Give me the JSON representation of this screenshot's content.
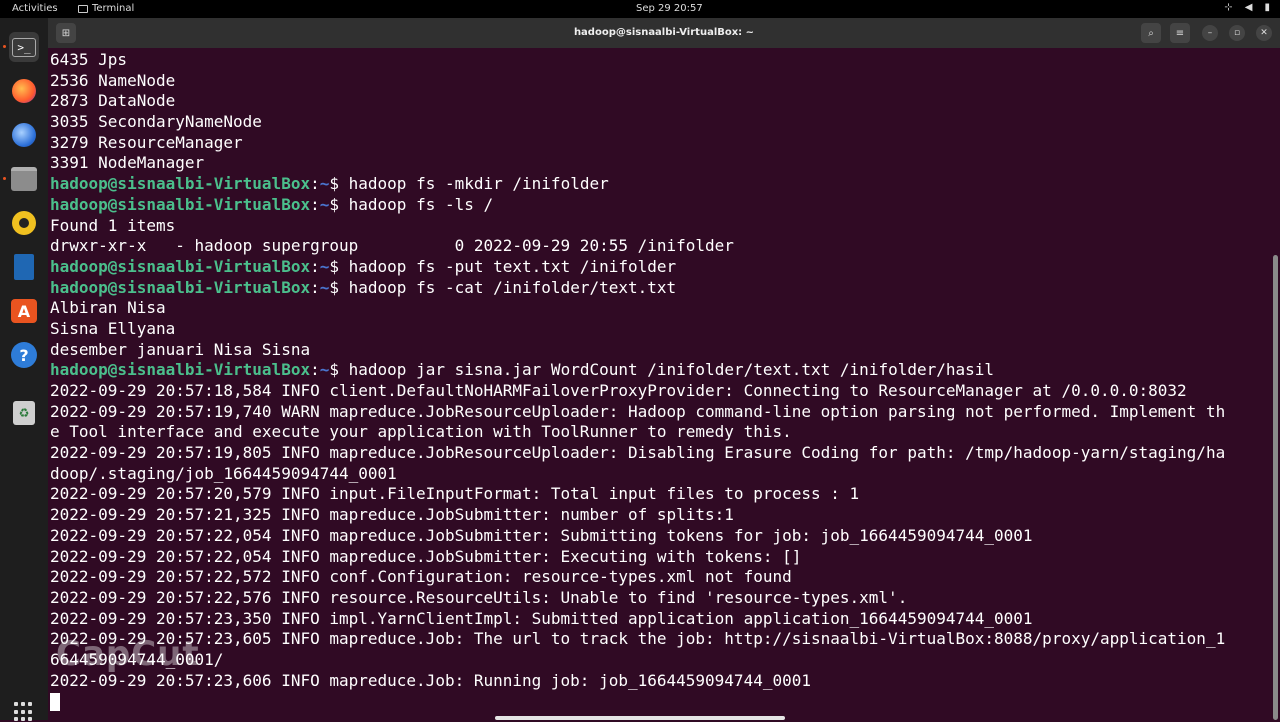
{
  "topbar": {
    "activities": "Activities",
    "app_name": "Terminal",
    "clock": "Sep 29  20:57"
  },
  "window": {
    "title": "hadoop@sisnaalbi-VirtualBox: ~"
  },
  "dock": {
    "items": [
      "terminal",
      "firefox",
      "thunderbird",
      "files",
      "rhythmbox",
      "libreoffice-writer",
      "app-center",
      "help",
      "trash"
    ]
  },
  "terminal": {
    "lines": [
      {
        "text": "6435 Jps"
      },
      {
        "text": "2536 NameNode"
      },
      {
        "text": "2873 DataNode"
      },
      {
        "text": "3035 SecondaryNameNode"
      },
      {
        "text": "3279 ResourceManager"
      },
      {
        "text": "3391 NodeManager"
      },
      {
        "prompt": true,
        "user": "hadoop@sisnaalbi-VirtualBox",
        "path": "~",
        "cmd": "$ hadoop fs -mkdir /inifolder"
      },
      {
        "prompt": true,
        "user": "hadoop@sisnaalbi-VirtualBox",
        "path": "~",
        "cmd": "$ hadoop fs -ls /"
      },
      {
        "text": "Found 1 items"
      },
      {
        "text": "drwxr-xr-x   - hadoop supergroup          0 2022-09-29 20:55 /inifolder"
      },
      {
        "prompt": true,
        "user": "hadoop@sisnaalbi-VirtualBox",
        "path": "~",
        "cmd": "$ hadoop fs -put text.txt /inifolder"
      },
      {
        "prompt": true,
        "user": "hadoop@sisnaalbi-VirtualBox",
        "path": "~",
        "cmd": "$ hadoop fs -cat /inifolder/text.txt"
      },
      {
        "text": "Albiran Nisa"
      },
      {
        "text": "Sisna Ellyana"
      },
      {
        "text": "desember januari Nisa Sisna"
      },
      {
        "prompt": true,
        "user": "hadoop@sisnaalbi-VirtualBox",
        "path": "~",
        "cmd": "$ hadoop jar sisna.jar WordCount /inifolder/text.txt /inifolder/hasil"
      },
      {
        "text": "2022-09-29 20:57:18,584 INFO client.DefaultNoHARMFailoverProxyProvider: Connecting to ResourceManager at /0.0.0.0:8032"
      },
      {
        "text": "2022-09-29 20:57:19,740 WARN mapreduce.JobResourceUploader: Hadoop command-line option parsing not performed. Implement th"
      },
      {
        "text": "e Tool interface and execute your application with ToolRunner to remedy this."
      },
      {
        "text": "2022-09-29 20:57:19,805 INFO mapreduce.JobResourceUploader: Disabling Erasure Coding for path: /tmp/hadoop-yarn/staging/ha"
      },
      {
        "text": "doop/.staging/job_1664459094744_0001"
      },
      {
        "text": "2022-09-29 20:57:20,579 INFO input.FileInputFormat: Total input files to process : 1"
      },
      {
        "text": "2022-09-29 20:57:21,325 INFO mapreduce.JobSubmitter: number of splits:1"
      },
      {
        "text": "2022-09-29 20:57:22,054 INFO mapreduce.JobSubmitter: Submitting tokens for job: job_1664459094744_0001"
      },
      {
        "text": "2022-09-29 20:57:22,054 INFO mapreduce.JobSubmitter: Executing with tokens: []"
      },
      {
        "text": "2022-09-29 20:57:22,572 INFO conf.Configuration: resource-types.xml not found"
      },
      {
        "text": "2022-09-29 20:57:22,576 INFO resource.ResourceUtils: Unable to find 'resource-types.xml'."
      },
      {
        "text": "2022-09-29 20:57:23,350 INFO impl.YarnClientImpl: Submitted application application_1664459094744_0001"
      },
      {
        "text": "2022-09-29 20:57:23,605 INFO mapreduce.Job: The url to track the job: http://sisnaalbi-VirtualBox:8088/proxy/application_1"
      },
      {
        "text": "664459094744_0001/"
      },
      {
        "text": "2022-09-29 20:57:23,606 INFO mapreduce.Job: Running job: job_1664459094744_0001"
      },
      {
        "cursor": true
      }
    ]
  },
  "watermark": "CapCut",
  "colors": {
    "terminal_bg": "#300a24",
    "prompt_user": "#4bbf8c",
    "prompt_path": "#4a76d0"
  }
}
